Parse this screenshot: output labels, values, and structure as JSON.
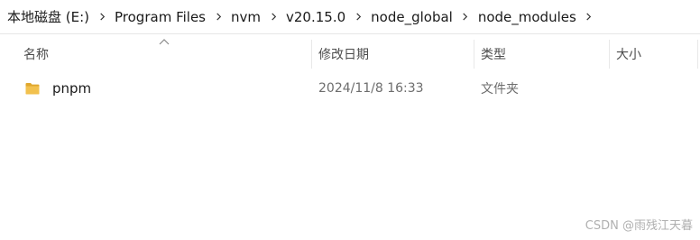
{
  "breadcrumb": [
    "本地磁盘 (E:)",
    "Program Files",
    "nvm",
    "v20.15.0",
    "node_global",
    "node_modules"
  ],
  "columns": {
    "name": "名称",
    "date": "修改日期",
    "type": "类型",
    "size": "大小"
  },
  "files": [
    {
      "name": "pnpm",
      "modified": "2024/11/8 16:33",
      "type": "文件夹",
      "size": ""
    }
  ],
  "watermark": "CSDN @雨残江天暮",
  "colors": {
    "folder": "#f2c14e",
    "folder_dark": "#e0a82e",
    "hover": "#e5f3ff"
  },
  "icons": {
    "breadcrumb_separator": "chevron-right-icon",
    "folder": "folder-icon",
    "sort": "sort-up-icon"
  }
}
